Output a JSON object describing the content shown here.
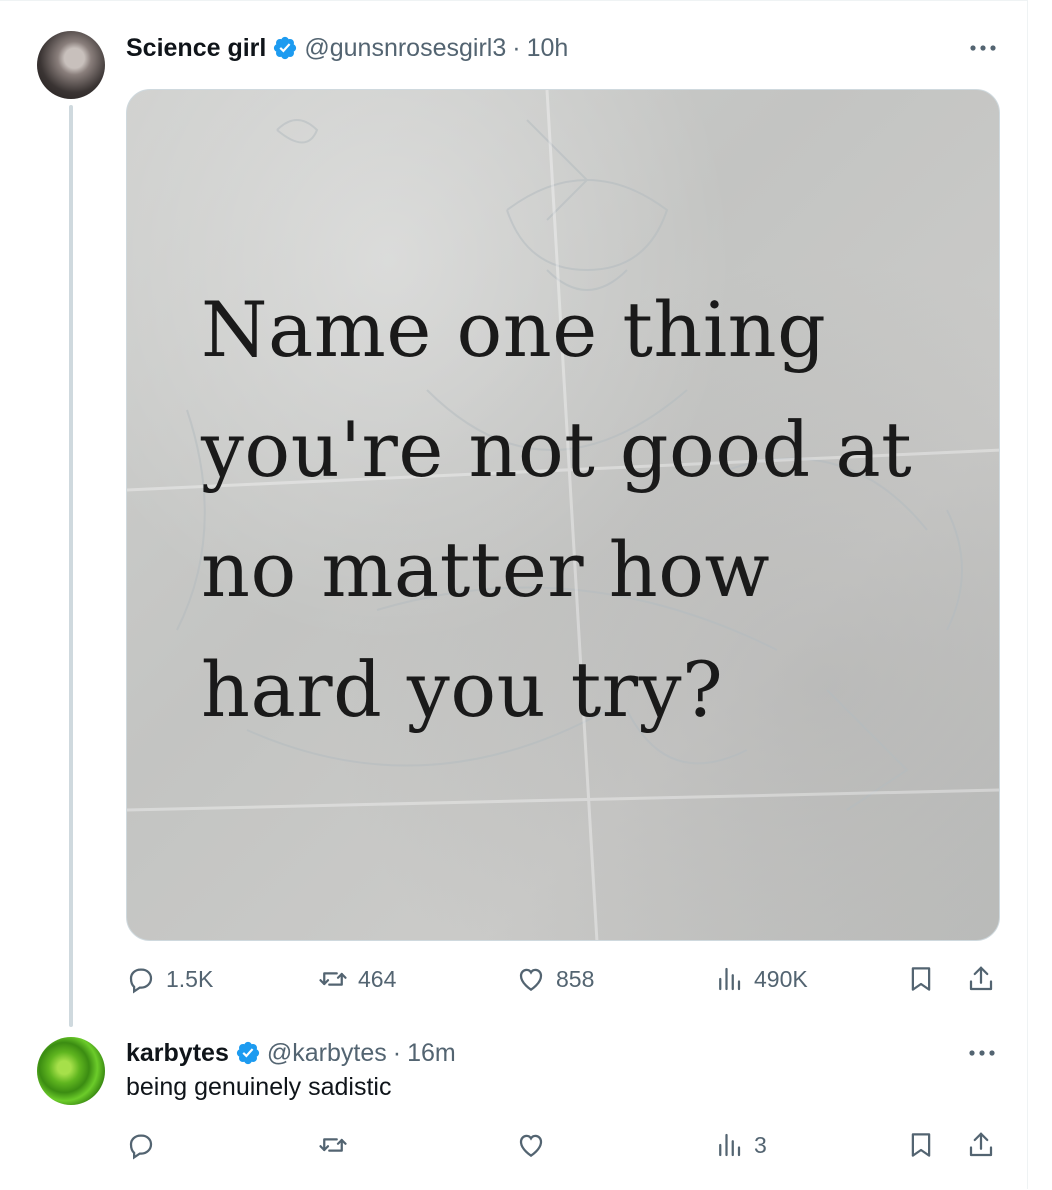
{
  "main_tweet": {
    "author_name": "Science girl",
    "handle": "@gunsnrosesgirl3",
    "separator": "·",
    "time": "10h",
    "image_text": [
      "Name one thing",
      "you're not good at",
      "no matter how",
      "hard you try?"
    ],
    "stats": {
      "replies": "1.5K",
      "reposts": "464",
      "likes": "858",
      "views": "490K"
    }
  },
  "reply_tweet": {
    "author_name": "karbytes",
    "handle": "@karbytes",
    "separator": "·",
    "time": "16m",
    "text": "being genuinely sadistic",
    "stats": {
      "views": "3"
    }
  },
  "colors": {
    "verified": "#1d9bf0",
    "muted": "#536471",
    "thread_line": "#cfd9de",
    "text": "#0f1419"
  },
  "icons": [
    "verified-badge-icon",
    "more-icon",
    "reply-icon",
    "repost-icon",
    "like-icon",
    "views-icon",
    "bookmark-icon",
    "share-icon"
  ]
}
